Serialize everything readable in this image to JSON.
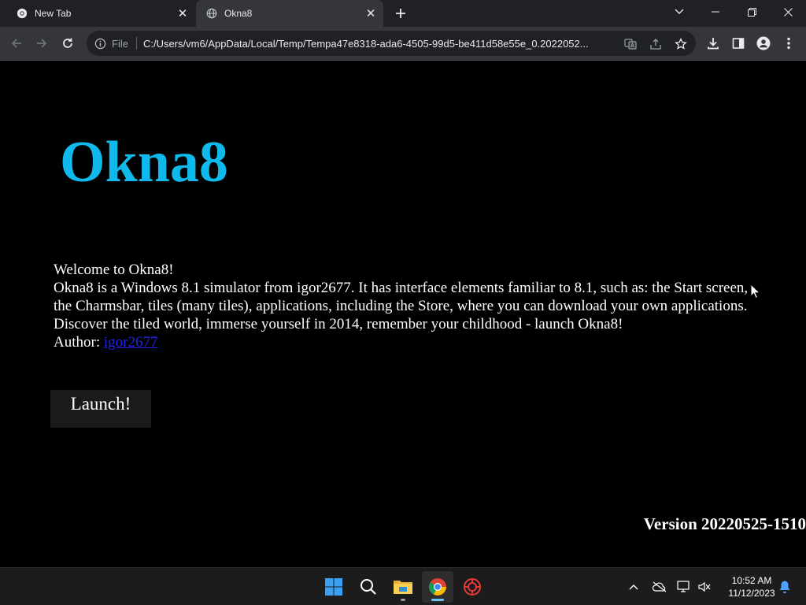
{
  "browser": {
    "tabs": [
      {
        "title": "New Tab",
        "active": false
      },
      {
        "title": "Okna8",
        "active": true
      }
    ],
    "omnibox": {
      "scheme_label": "File",
      "url": "C:/Users/vm6/AppData/Local/Temp/Tempa47e8318-ada6-4505-99d5-be411d58e55e_0.2022052..."
    }
  },
  "page": {
    "brand_title": "Okna8",
    "welcome": "Welcome to Okna8!",
    "description": "Okna8 is a Windows 8.1 simulator from igor2677. It has interface elements familiar to 8.1, such as: the Start screen, the Charmsbar, tiles (many tiles), applications, including the Store, where you can download your own applications.",
    "discover": "Discover the tiled world, immerse yourself in 2014, remember your childhood - launch Okna8!",
    "author_label": "Author:",
    "author_link": "igor2677",
    "launch_label": "Launch!",
    "version": "Version 20220525-1510"
  },
  "taskbar": {
    "apps": [
      "start-icon",
      "search-icon",
      "file-explorer-icon",
      "chrome-icon",
      "app-icon"
    ],
    "clock_time": "10:52 AM",
    "clock_date": "11/12/2023"
  },
  "colors": {
    "brand": "#0fb9ec",
    "link": "#2222ee",
    "chrome_dark": "#202124",
    "chrome_toolbar": "#35363a"
  }
}
